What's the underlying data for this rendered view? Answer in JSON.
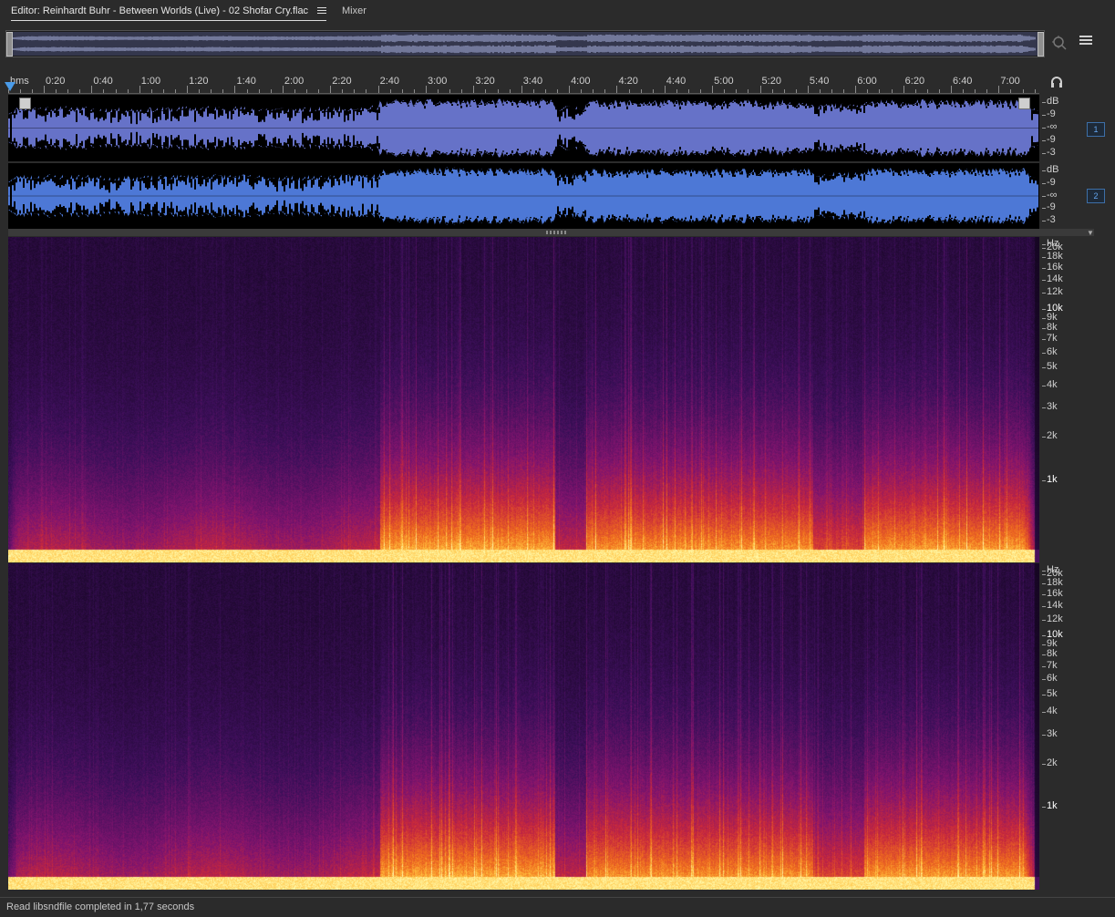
{
  "tabs": {
    "editor_label": "Editor: Reinhardt Buhr - Between Worlds (Live) - 02 Shofar Cry.flac",
    "mixer_label": "Mixer"
  },
  "icons": {
    "tab_menu": "hamburger-menu-icon",
    "zoom": "zoom-icon",
    "panel_menu": "list-menu-icon",
    "headphones": "headphones-icon"
  },
  "ruler": {
    "unit": "hms",
    "labels": [
      "0:20",
      "0:40",
      "1:00",
      "1:20",
      "1:40",
      "2:00",
      "2:20",
      "2:40",
      "3:00",
      "3:20",
      "3:40",
      "4:00",
      "4:20",
      "4:40",
      "5:00",
      "5:20",
      "5:40",
      "6:00",
      "6:20",
      "6:40",
      "7:00"
    ]
  },
  "waveform": {
    "channels": [
      {
        "badge": "1",
        "scale": [
          "dB",
          "-9",
          "-∞",
          "-9",
          "-3"
        ],
        "color": "#6672c8"
      },
      {
        "badge": "2",
        "scale": [
          "dB",
          "-9",
          "-∞",
          "-9",
          "-3"
        ],
        "color": "#4d78d6"
      }
    ]
  },
  "spectrogram": {
    "scale": [
      "Hz",
      "20k",
      "18k",
      "16k",
      "14k",
      "12k",
      "10k",
      "9k",
      "8k",
      "7k",
      "6k",
      "5k",
      "4k",
      "3k",
      "2k",
      "1k"
    ]
  },
  "status": {
    "text": "Read libsndfile completed in 1,77 seconds"
  }
}
